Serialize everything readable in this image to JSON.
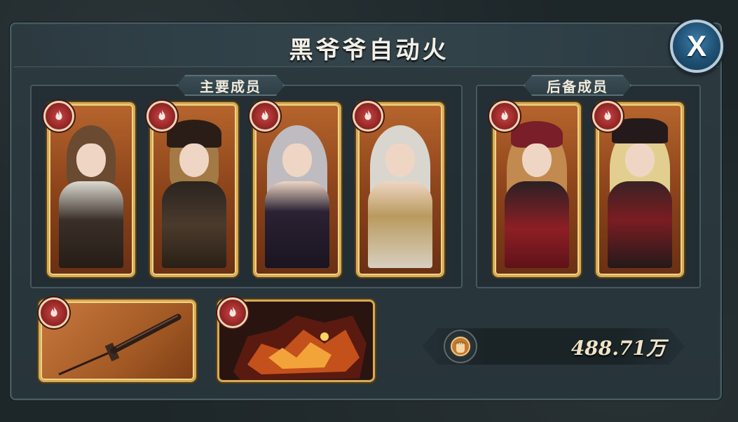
{
  "title": "黑爷爷自动火",
  "close_button": {
    "label": "X"
  },
  "main_group": {
    "label": "主要成员",
    "members": [
      {
        "name": "character-1",
        "element_icon": "fire-icon"
      },
      {
        "name": "character-2",
        "element_icon": "fire-icon"
      },
      {
        "name": "character-3",
        "element_icon": "fire-icon"
      },
      {
        "name": "character-4",
        "element_icon": "fire-icon"
      }
    ]
  },
  "backup_group": {
    "label": "后备成员",
    "members": [
      {
        "name": "character-5",
        "element_icon": "fire-icon"
      },
      {
        "name": "character-6",
        "element_icon": "fire-icon"
      }
    ]
  },
  "equipment": [
    {
      "name": "weapon-sword",
      "element_icon": "fire-icon"
    },
    {
      "name": "beast-lava",
      "element_icon": "fire-icon"
    }
  ],
  "power": {
    "icon": "fist-icon",
    "value": "488.71万"
  },
  "colors": {
    "card_border": "#d6ab56",
    "card_bg": "#a4581f",
    "badge": "#a52b2b",
    "close_button": "#1e4f72"
  }
}
